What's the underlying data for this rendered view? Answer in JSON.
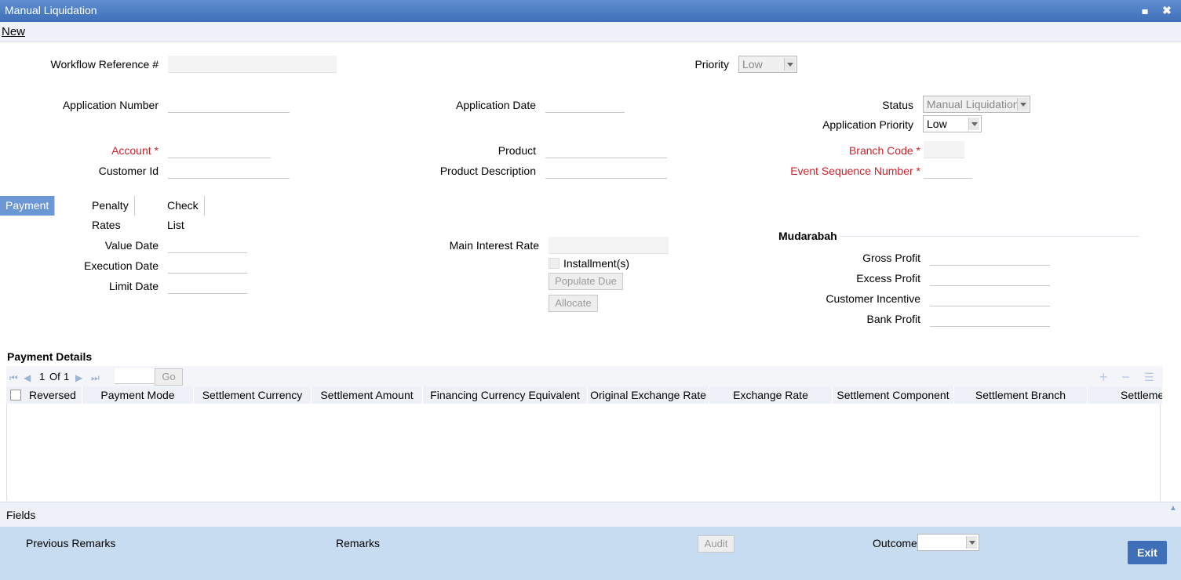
{
  "window": {
    "title": "Manual Liquidation",
    "minimize": "▄",
    "close": "✖"
  },
  "menu": {
    "new": "New"
  },
  "form": {
    "workflow_ref_label": "Workflow Reference #",
    "priority_label": "Priority",
    "priority_value": "Low",
    "application_number_label": "Application Number",
    "application_date_label": "Application Date",
    "status_label": "Status",
    "status_value": "Manual Liquidation",
    "application_priority_label": "Application Priority",
    "application_priority_value": "Low",
    "account_label": "Account",
    "product_label": "Product",
    "branch_code_label": "Branch Code",
    "customer_id_label": "Customer Id",
    "product_description_label": "Product Description",
    "event_seq_label": "Event Sequence Number",
    "required_mark": "*"
  },
  "tabs": [
    "Payment Details",
    "Penalty Rates",
    "Check List"
  ],
  "payment": {
    "value_date_label": "Value Date",
    "execution_date_label": "Execution Date",
    "limit_date_label": "Limit Date",
    "main_interest_rate_label": "Main Interest Rate",
    "installments_label": "Installment(s)",
    "populate_due_button": "Populate Due",
    "allocate_button": "Allocate"
  },
  "mudarabah": {
    "title": "Mudarabah",
    "gross_profit_label": "Gross Profit",
    "excess_profit_label": "Excess Profit",
    "customer_incentive_label": "Customer Incentive",
    "bank_profit_label": "Bank Profit"
  },
  "grid": {
    "title": "Payment Details",
    "page_current": "1",
    "page_of": "Of",
    "page_total": "1",
    "go_button": "Go",
    "add_icon": "+",
    "remove_icon": "−",
    "columns": [
      "Reversed",
      "Payment Mode",
      "Settlement Currency",
      "Settlement Amount",
      "Financing Currency Equivalent",
      "Original Exchange Rate",
      "Exchange Rate",
      "Settlement Component",
      "Settlement Branch",
      "Settleme"
    ]
  },
  "footer": {
    "fields_label": "Fields",
    "previous_remarks_label": "Previous Remarks",
    "remarks_label": "Remarks",
    "audit_button": "Audit",
    "outcome_label": "Outcome",
    "exit_button": "Exit"
  }
}
